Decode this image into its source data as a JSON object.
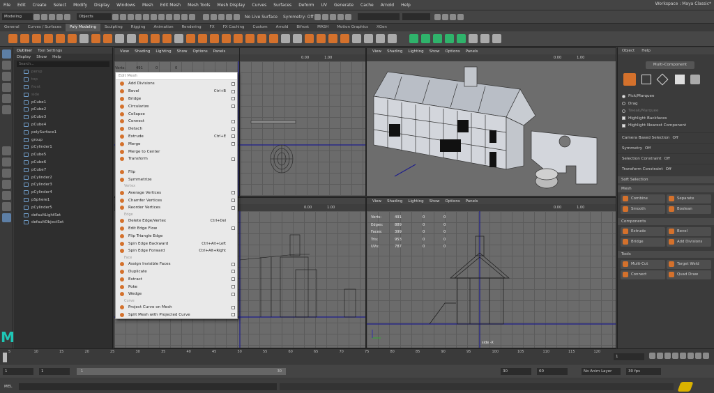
{
  "menubar": [
    "File",
    "Edit",
    "Create",
    "Select",
    "Modify",
    "Display",
    "Windows",
    "Mesh",
    "Edit Mesh",
    "Mesh Tools",
    "Mesh Display",
    "Curves",
    "Surfaces",
    "Deform",
    "UV",
    "Generate",
    "Cache",
    "Arnold",
    "Help"
  ],
  "workspace": "Workspace :  Maya Classic*",
  "status": {
    "mode": "Modeling",
    "objects": "Objects",
    "live": "No Live Surface",
    "symmetry": "Symmetry: Off"
  },
  "shelf_tabs": [
    "General",
    "Curves / Surfaces",
    "Poly Modeling",
    "Sculpting",
    "Rigging",
    "Animation",
    "Rendering",
    "FX",
    "FX Caching",
    "Custom",
    "Arnold",
    "Bifrost",
    "MASH",
    "Motion Graphics",
    "XGen"
  ],
  "outliner": {
    "tabs": [
      "Outliner",
      "Tool Settings"
    ],
    "menu": [
      "Display",
      "Show",
      "Help"
    ],
    "search": "Search...",
    "items": [
      {
        "label": "persp",
        "dim": true
      },
      {
        "label": "top",
        "dim": true
      },
      {
        "label": "front",
        "dim": true
      },
      {
        "label": "side",
        "dim": true
      },
      {
        "label": "pCube1"
      },
      {
        "label": "pCube2"
      },
      {
        "label": "pCube3"
      },
      {
        "label": "pCube4"
      },
      {
        "label": "polySurface1"
      },
      {
        "label": "group"
      },
      {
        "label": "pCylinder1"
      },
      {
        "label": "pCube5"
      },
      {
        "label": "pCube6"
      },
      {
        "label": "pCube7"
      },
      {
        "label": "pCylinder2"
      },
      {
        "label": "pCylinder3"
      },
      {
        "label": "pCylinder4"
      },
      {
        "label": "pSphere1"
      },
      {
        "label": "pCylinder5"
      },
      {
        "label": "defaultLightSet"
      },
      {
        "label": "defaultObjectSet"
      }
    ]
  },
  "viewport_menu": [
    "View",
    "Shading",
    "Lighting",
    "Show",
    "Options",
    "Panels"
  ],
  "vp_numbers": {
    "a": "0.00",
    "b": "1.00"
  },
  "hud_rows": [
    {
      "label": "Verts:",
      "v": "491",
      "a": "0",
      "b": "0"
    },
    {
      "label": "Edges:",
      "v": "889",
      "a": "0",
      "b": "0"
    },
    {
      "label": "Faces:",
      "v": "399",
      "a": "0",
      "b": "0"
    },
    {
      "label": "Tris:",
      "v": "953",
      "a": "0",
      "b": "0"
    },
    {
      "label": "UVs:",
      "v": "787",
      "a": "0",
      "b": "0"
    }
  ],
  "hud_small": {
    "label": "Verts:",
    "v": "491",
    "a": "0",
    "b": "0"
  },
  "side_label": "side -X",
  "edit_mesh": {
    "title": "Edit Mesh",
    "items": [
      {
        "type": "item",
        "label": "Add Divisions",
        "box": true
      },
      {
        "type": "item",
        "label": "Bevel",
        "sc": "Ctrl+B",
        "box": true
      },
      {
        "type": "item",
        "label": "Bridge",
        "box": true
      },
      {
        "type": "item",
        "label": "Circularize",
        "box": true
      },
      {
        "type": "item",
        "label": "Collapse"
      },
      {
        "type": "item",
        "label": "Connect",
        "box": true
      },
      {
        "type": "item",
        "label": "Detach",
        "box": true
      },
      {
        "type": "item",
        "label": "Extrude",
        "sc": "Ctrl+E",
        "box": true
      },
      {
        "type": "item",
        "label": "Merge",
        "box": true
      },
      {
        "type": "item",
        "label": "Merge to Center"
      },
      {
        "type": "item",
        "label": "Transform",
        "box": true
      },
      {
        "type": "sec",
        "label": ""
      },
      {
        "type": "item",
        "label": "Flip"
      },
      {
        "type": "item",
        "label": "Symmetrize"
      },
      {
        "type": "sec",
        "label": "Vertex"
      },
      {
        "type": "item",
        "label": "Average Vertices",
        "box": true
      },
      {
        "type": "item",
        "label": "Chamfer Vertices",
        "box": true
      },
      {
        "type": "item",
        "label": "Reorder Vertices",
        "box": true
      },
      {
        "type": "sec",
        "label": "Edge"
      },
      {
        "type": "item",
        "label": "Delete Edge/Vertex",
        "sc": "Ctrl+Del"
      },
      {
        "type": "item",
        "label": "Edit Edge Flow",
        "box": true
      },
      {
        "type": "item",
        "label": "Flip Triangle Edge"
      },
      {
        "type": "item",
        "label": "Spin Edge Backward",
        "sc": "Ctrl+Alt+Left"
      },
      {
        "type": "item",
        "label": "Spin Edge Forward",
        "sc": "Ctrl+Alt+Right"
      },
      {
        "type": "sec",
        "label": "Face"
      },
      {
        "type": "item",
        "label": "Assign Invisible Faces",
        "box": true
      },
      {
        "type": "item",
        "label": "Duplicate",
        "box": true
      },
      {
        "type": "item",
        "label": "Extract",
        "box": true
      },
      {
        "type": "item",
        "label": "Poke",
        "box": true
      },
      {
        "type": "item",
        "label": "Wedge",
        "box": true
      },
      {
        "type": "sec",
        "label": "Curve"
      },
      {
        "type": "item",
        "label": "Project Curve on Mesh",
        "box": true
      },
      {
        "type": "item",
        "label": "Split Mesh with Projected Curve",
        "box": true
      }
    ]
  },
  "right_panel": {
    "menu": [
      "Object",
      "Help"
    ],
    "mode": "Multi-Component",
    "options": [
      {
        "label": "Pick/Marquee",
        "on": true
      },
      {
        "label": "Drag",
        "on": false
      },
      {
        "label": "Tweak/Marquee",
        "on": false,
        "dim": true
      },
      {
        "label": "Highlight Backfaces",
        "check": true
      },
      {
        "label": "Highlight Nearest Component",
        "check": true
      }
    ],
    "props": [
      {
        "k": "Camera Based Selection",
        "v": "Off"
      },
      {
        "k": "Symmetry",
        "v": "Off"
      },
      {
        "k": "Selection Constraint",
        "v": "Off"
      },
      {
        "k": "Transform Constraint",
        "v": "Off"
      }
    ],
    "soft": "Soft Selection",
    "sections": [
      {
        "title": "Mesh",
        "buttons": [
          "Combine",
          "Separate",
          "Smooth",
          "Boolean"
        ]
      },
      {
        "title": "Components",
        "buttons": [
          "Extrude",
          "Bevel",
          "Bridge",
          "Add Divisions"
        ]
      },
      {
        "title": "Tools",
        "buttons": [
          "Multi-Cut",
          "Target Weld",
          "Connect",
          "Quad Draw"
        ]
      }
    ]
  },
  "timeline": {
    "ticks": [
      "5",
      "10",
      "15",
      "20",
      "25",
      "30",
      "35",
      "40",
      "45",
      "50",
      "55",
      "60",
      "65",
      "70",
      "75",
      "80",
      "85",
      "90",
      "95",
      "100",
      "105",
      "110",
      "115",
      "120"
    ],
    "current": "1"
  },
  "range": {
    "start": "1",
    "start2": "1",
    "inner_start": "1",
    "inner_end": "30",
    "end": "30",
    "end2": "60",
    "anim_layer": "No Anim Layer",
    "fps": "30 fps"
  },
  "cmd": {
    "label": "MEL"
  },
  "colors": {
    "accent": "#d4712c",
    "axis_blue": "#1d1d8c"
  }
}
